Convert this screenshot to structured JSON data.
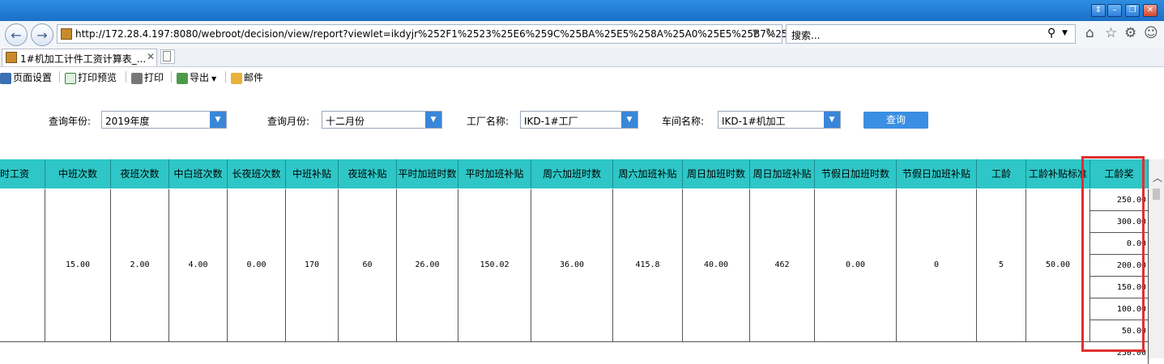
{
  "browser": {
    "url": "http://172.28.4.197:8080/webroot/decision/view/report?viewlet=ikdyjr%252F1%2523%25E6%259C%25BA%25E5%258A%25A0%25E5%25B7%25",
    "search_placeholder": "搜索...",
    "tab_title": "1#机加工计件工资计算表_..."
  },
  "toolbar": {
    "page_setup": "页面设置",
    "print_preview": "打印预览",
    "print": "打印",
    "export": "导出",
    "mail": "邮件"
  },
  "filters": {
    "year_label": "查询年份:",
    "year_value": "2019年度",
    "month_label": "查询月份:",
    "month_value": "十二月份",
    "factory_label": "工厂名称:",
    "factory_value": "IKD-1#工厂",
    "workshop_label": "车间名称:",
    "workshop_value": "IKD-1#机加工",
    "query_button": "查询"
  },
  "table": {
    "headers": [
      "时工资",
      "中班次数",
      "夜班次数",
      "中白班次数",
      "长夜班次数",
      "中班补贴",
      "夜班补贴",
      "平时加班时数",
      "平时加班补贴",
      "周六加班时数",
      "周六加班补贴",
      "周日加班时数",
      "周日加班补贴",
      "节假日加班时数",
      "节假日加班补贴",
      "工龄",
      "工龄补贴标准",
      "工龄奖"
    ],
    "row": [
      "",
      "15.00",
      "2.00",
      "4.00",
      "0.00",
      "170",
      "60",
      "26.00",
      "150.02",
      "36.00",
      "415.8",
      "40.00",
      "462",
      "0.00",
      "0",
      "5",
      "50.00"
    ],
    "seniority_bonus": [
      "250.00",
      "300.00",
      "0.00",
      "200.00",
      "150.00",
      "100.00",
      "50.00"
    ],
    "next_row_bonus": "250.00"
  },
  "colors": {
    "header_bg": "#2ec6c6",
    "highlight": "#e0302f",
    "query_button": "#3a8fe2"
  }
}
